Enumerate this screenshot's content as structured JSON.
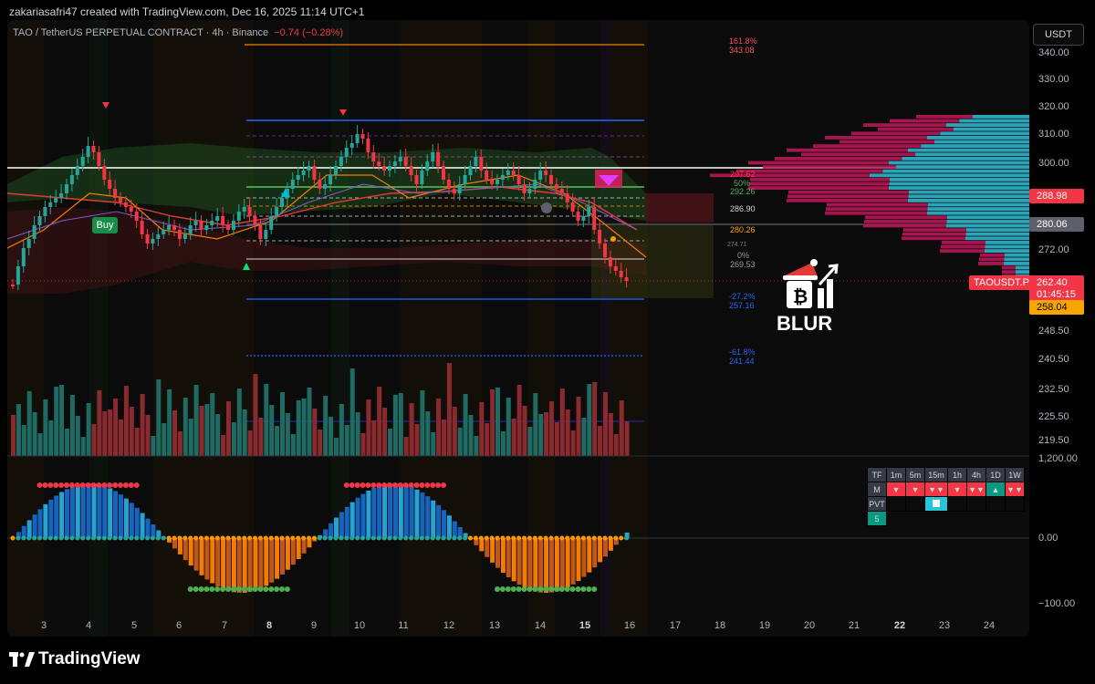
{
  "header": {
    "credit": "zakariasafri47 created with TradingView.com, Dec 16, 2025 11:14 UTC+1"
  },
  "symbol": {
    "title": "TAO / TetherUS PERPETUAL CONTRACT · 4h · Binance",
    "change": "−0.74 (−0.28%)",
    "currency": "USDT"
  },
  "price_axis": {
    "ticks": [
      "340.00",
      "330.00",
      "320.00",
      "310.00",
      "300.00",
      "272.00",
      "248.50",
      "240.50",
      "232.50",
      "225.50",
      "219.50"
    ],
    "labels": {
      "top_red": "288.98",
      "gray": "280.06",
      "ticker": "TAOUSDT.P",
      "last_price": "262.40",
      "countdown": "01:45:15",
      "yellow": "258.04"
    },
    "osc_ticks": [
      "1,200.00",
      "0.00",
      "−100.00"
    ]
  },
  "fib_labels": [
    {
      "pct": "161.8%",
      "price": "343.08",
      "color": "#f7525f"
    },
    {
      "pct": "-27.2%",
      "price": "257.16",
      "color": "#2962ff"
    },
    {
      "pct": "-61.8%",
      "price": "241.44",
      "color": "#2962ff"
    }
  ],
  "fib_small": [
    {
      "text": "297.62",
      "color": "#f23645"
    },
    {
      "text": "50%",
      "color": "#4caf50"
    },
    {
      "text": "292.26",
      "color": "#4caf50"
    },
    {
      "text": "286.90",
      "color": "#d1d4dc"
    },
    {
      "text": "280.26",
      "color": "#f7a600"
    },
    {
      "text": "0%",
      "color": "#9598a1"
    },
    {
      "text": "269.53",
      "color": "#9598a1"
    },
    {
      "text": "274.71",
      "color": "#787b86"
    }
  ],
  "buy_label": "Buy",
  "blur_text": "BLUR",
  "dates": [
    "3",
    "4",
    "5",
    "6",
    "7",
    "8",
    "9",
    "10",
    "11",
    "12",
    "13",
    "14",
    "15",
    "16",
    "17",
    "18",
    "19",
    "20",
    "21",
    "22",
    "23",
    "24"
  ],
  "mtf_table": {
    "headers": [
      "TF",
      "1m",
      "5m",
      "15m",
      "1h",
      "4h",
      "1D",
      "1W"
    ],
    "row_m": [
      "M",
      "▼",
      "▼",
      "▼▼",
      "▼",
      "▼▼",
      "▲",
      "▼▼"
    ],
    "row_pvt": [
      "PVT",
      "",
      "",
      "",
      "",
      "",
      "",
      ""
    ],
    "row_5": "5"
  },
  "footer": {
    "logo_text": "TradingView"
  },
  "colors": {
    "up": "#26a69a",
    "down": "#f23645",
    "background": "#0b0b0b"
  }
}
